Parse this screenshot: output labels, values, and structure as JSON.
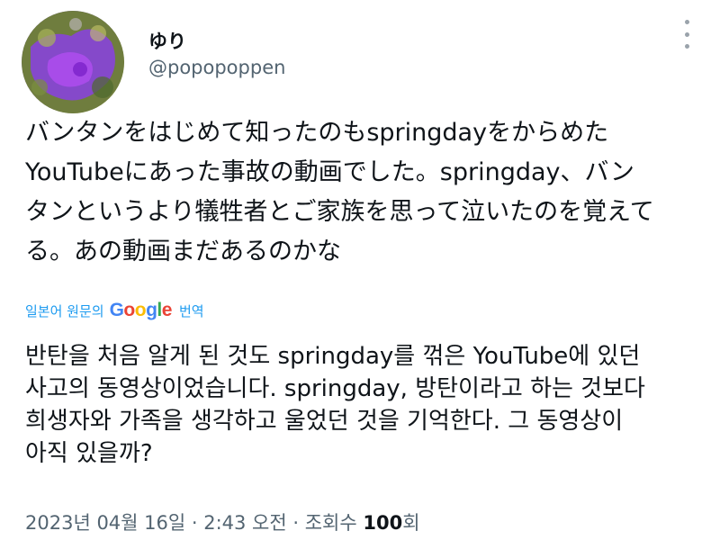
{
  "author": {
    "display_name": "ゆり",
    "handle": "@popopoppen"
  },
  "more_icon": "more-vertical-icon",
  "tweet": {
    "lines": [
      "バンタンをはじめて知ったのもspringdayをからめた",
      "YouTubeにあった事故の動画でした。springday、バン",
      "タンというより犠牲者とご家族を思って泣いたのを覚えて",
      "る。あの動画まだあるのかな"
    ]
  },
  "translation": {
    "label_left": "일본어 원문의",
    "google": "Google",
    "label_right": "번역",
    "lines": [
      "반탄을 처음 알게 된 것도 springday를 꺾은 YouTube에 있던",
      "사고의 동영상이었습니다. springday, 방탄이라고 하는 것보다",
      "희생자와 가족을 생각하고 울었던 것을 기억한다. 그 동영상이",
      "아직 있을까?"
    ]
  },
  "meta": {
    "timestamp": "2023년 04월 16일 · 2:43 오전 · 조회수",
    "views": "100",
    "views_suffix": "회"
  },
  "colors": {
    "link_blue": "#1d9bf0",
    "secondary_text": "#536471",
    "primary_text": "#0f1419"
  }
}
